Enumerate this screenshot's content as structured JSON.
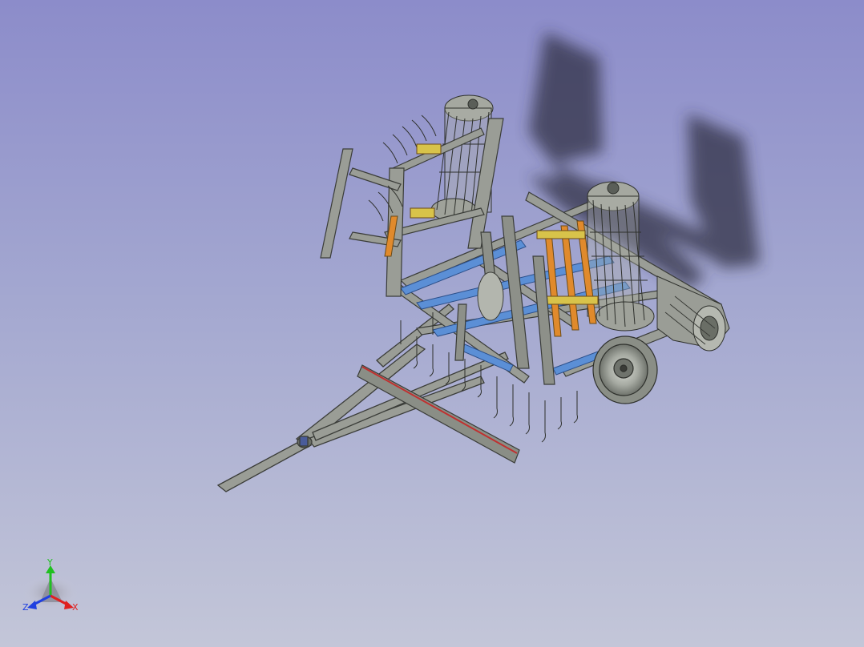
{
  "viewer": {
    "background_top": "#8c8cca",
    "background_bottom": "#c3c6d8",
    "model_color": "#8a8e86",
    "frame_blue": "#5b8fd6",
    "accent_orange": "#e08a2c",
    "accent_yellow": "#d8c34a"
  },
  "axis_triad": {
    "x_label": "X",
    "y_label": "Y",
    "z_label": "Z",
    "x_color": "#e02020",
    "y_color": "#20c020",
    "z_color": "#2040e0"
  }
}
